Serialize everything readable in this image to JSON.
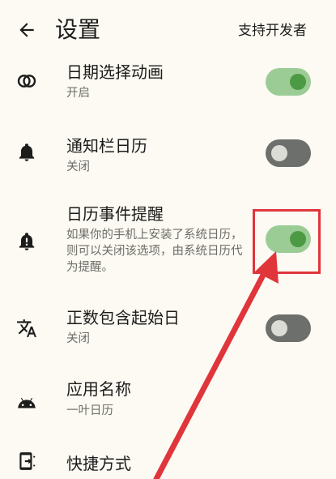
{
  "appbar": {
    "title": "设置",
    "action": "支持开发者"
  },
  "settings": [
    {
      "title": "日期选择动画",
      "subtitle": "开启",
      "icon": "circles-icon",
      "toggle": "on"
    },
    {
      "title": "通知栏日历",
      "subtitle": "关闭",
      "icon": "bell-icon",
      "toggle": "off"
    },
    {
      "title": "日历事件提醒",
      "subtitle": "如果你的手机上安装了系统日历，则可以关闭该选项，由系统日历代为提醒。",
      "icon": "bell-alert-icon",
      "toggle": "on"
    },
    {
      "title": "正数包含起始日",
      "subtitle": "关闭",
      "icon": "translate-icon",
      "toggle": "off"
    },
    {
      "title": "应用名称",
      "subtitle": "一叶日历",
      "icon": "android-icon",
      "toggle": null
    },
    {
      "title": "快捷方式",
      "subtitle": "",
      "icon": "shortcut-icon",
      "toggle": null
    }
  ],
  "annotation": {
    "color": "#e0353b",
    "highlight_target": "日历事件提醒 toggle"
  },
  "colors": {
    "accent": "#4c9a44",
    "toggle_on_track": "#9ccc96",
    "toggle_off_track": "#6c6f6b",
    "background": "#fcfaf3"
  }
}
